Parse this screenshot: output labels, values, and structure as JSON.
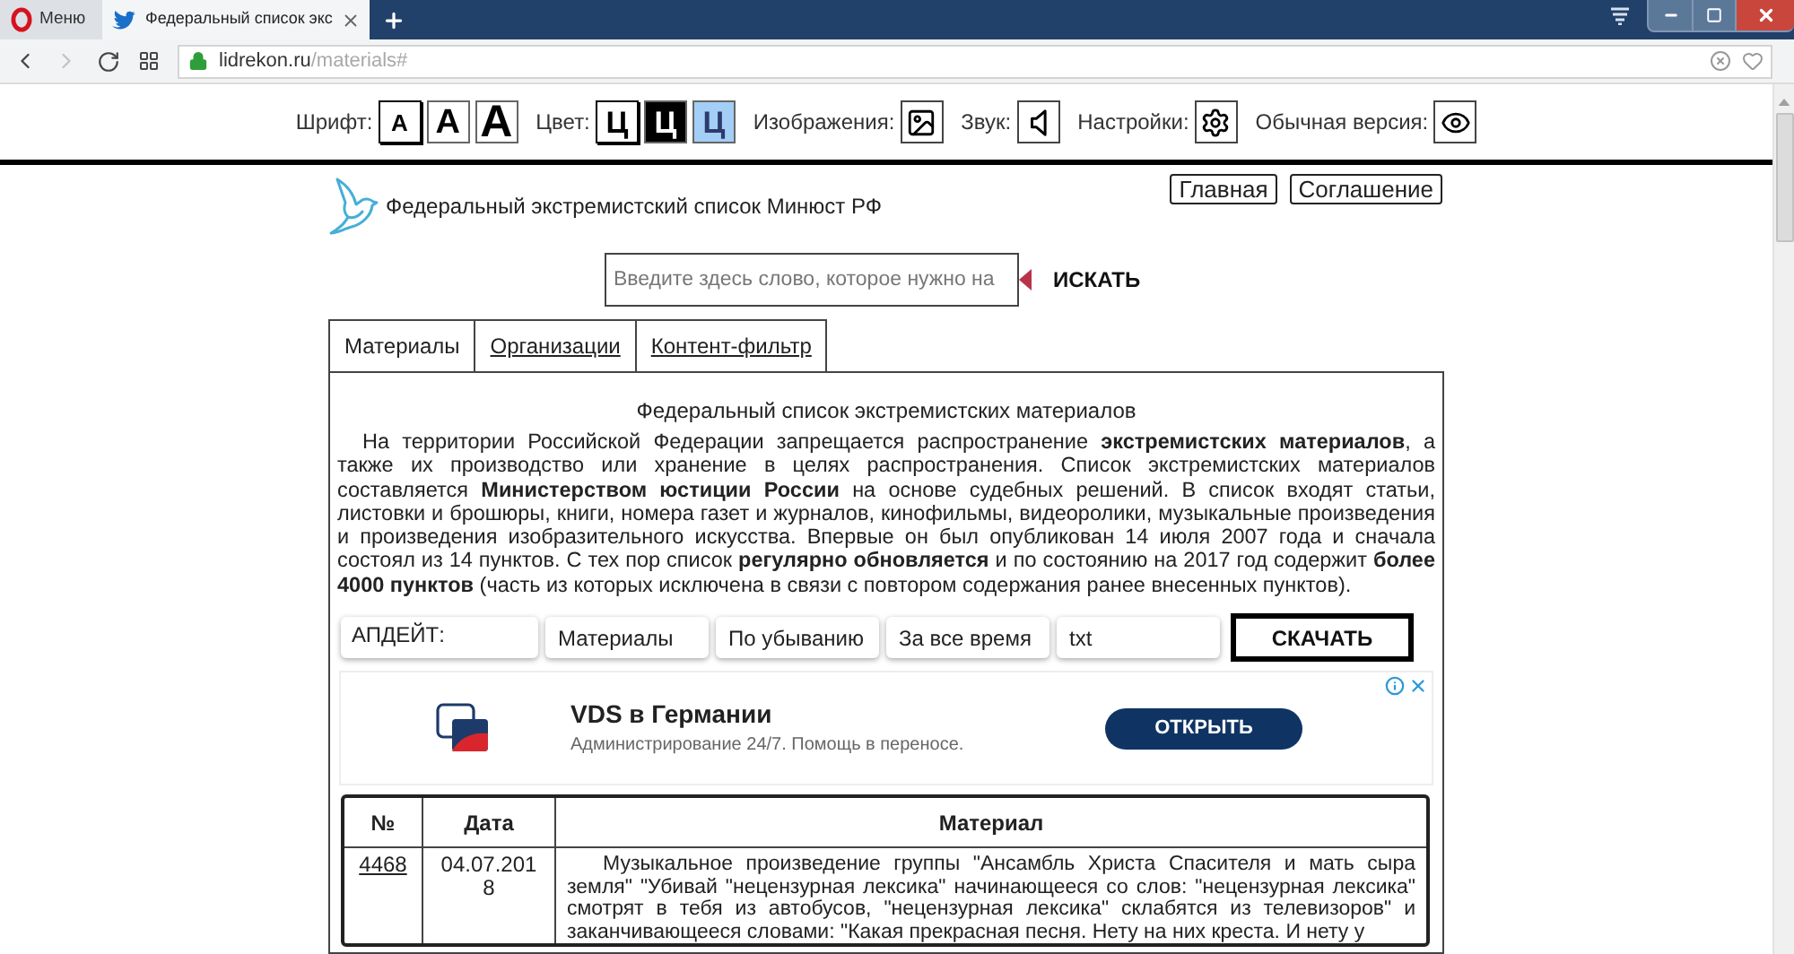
{
  "browser": {
    "menu_label": "Меню",
    "tabs": [
      {
        "title": "Федеральный список экс",
        "selected": true
      }
    ],
    "forward_button": {
      "disabled": true
    },
    "url": {
      "domain": "lidrekon.ru",
      "path": "/materials#"
    }
  },
  "accessibility_bar": {
    "font": {
      "label": "Шрифт:",
      "options": [
        {
          "label": "А",
          "kind": "small",
          "selected": true
        },
        {
          "label": "А",
          "kind": "medium",
          "selected": false
        },
        {
          "label": "А",
          "kind": "large",
          "selected": false
        }
      ]
    },
    "color": {
      "label": "Цвет:",
      "options": [
        {
          "label": "Ц",
          "color": "#ffffff",
          "selected": true
        },
        {
          "label": "Ц",
          "color": "#000000",
          "selected": false
        },
        {
          "label": "Ц",
          "color": "#a3cef5",
          "selected": false
        }
      ]
    },
    "tools": [
      {
        "label": "Изображения:",
        "kind": "image"
      },
      {
        "label": "Звук:",
        "kind": "sound"
      },
      {
        "label": "Настройки:",
        "kind": "settings"
      },
      {
        "label": "Обычная версия:",
        "kind": "view"
      }
    ]
  },
  "site_header": {
    "title": "Федеральный экстремистский список Минюст РФ",
    "nav": [
      "Главная",
      "Соглашение"
    ]
  },
  "search": {
    "placeholder": "Введите здесь слово, которое нужно на",
    "button": "ИСКАТЬ"
  },
  "tabs": [
    {
      "label": "Материалы",
      "selected": true
    },
    {
      "label": "Организации",
      "selected": false
    },
    {
      "label": "Контент-фильтр",
      "selected": false
    }
  ],
  "panel": {
    "heading": "Федеральный список экстремистских материалов",
    "intro": "На территории Российской Федерации запрещается распространение **экстремистских материалов**, а также их производство или хранение в целях распространения. Список экстремистских материалов составляется **Министерством юстиции России** на основе судебных решений. В список входят статьи, листовки и брошюры, книги, номера газет и журналов, кинофильмы, видеоролики, музыкальные произведения и произведения изобразительного искусства. Впервые он был опубликован 14 июля 2007 года и сначала состоял из 14 пунктов. С тех пор список **регулярно обновляется** и по состоянию на 2017 год содержит **более 4000 пунктов** (часть из которых исключена в связи с повтором содержания ранее внесенных пунктов)."
  },
  "filters": {
    "update_label": "АПДЕЙТ:",
    "options": [
      "Материалы",
      "По убыванию",
      "За все время",
      "txt"
    ],
    "download": "СКАЧАТЬ"
  },
  "ad": {
    "title": "VDS в Германии",
    "description": "Администрирование 24/7. Помощь в переносе.",
    "button": "ОТКРЫТЬ"
  },
  "table": {
    "columns": [
      "№",
      "Дата",
      "Материал"
    ],
    "rows": [
      {
        "number": "4468",
        "date": "04.07.2018",
        "material": "Музыкальное произведение группы \"Ансамбль Христа Спасителя и мать сыра земля\" \"Убивай \"нецензурная лексика\" начинающееся со слов: \"нецензурная лексика\" смотрят в тебя из автобусов, \"нецензурная лексика\" склабятся из телевизоров\" и заканчивающееся словами: \"Какая прекрасная песня. Нету на них креста. И нету у"
      }
    ]
  }
}
